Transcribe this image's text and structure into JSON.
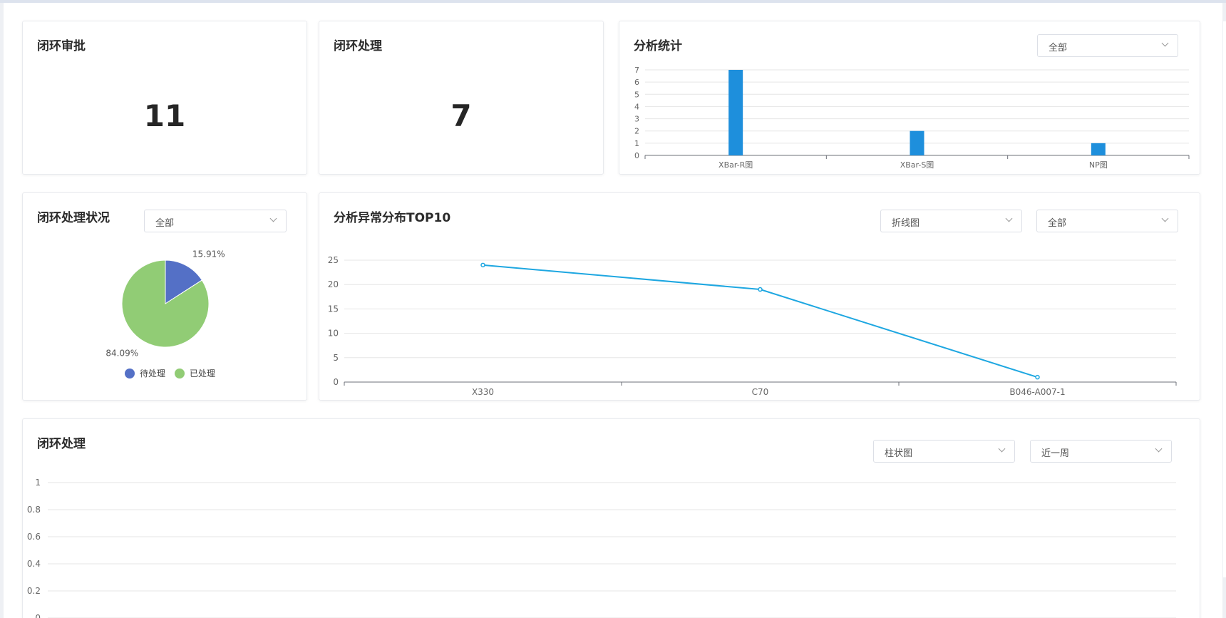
{
  "approval": {
    "title": "闭环审批",
    "value": "11"
  },
  "processing": {
    "title": "闭环处理",
    "value": "7"
  },
  "analysis_stats": {
    "title": "分析统计",
    "filter": "全部",
    "chart_data": {
      "type": "bar",
      "categories": [
        "XBar-R图",
        "XBar-S图",
        "NP图"
      ],
      "values": [
        7,
        2,
        1
      ],
      "yticks": [
        "0",
        "1",
        "2",
        "3",
        "4",
        "5",
        "6",
        "7"
      ],
      "ylim": [
        0,
        7
      ],
      "color": "#1e8fdc"
    }
  },
  "status": {
    "title": "闭环处理状况",
    "filter": "全部",
    "chart_data": {
      "type": "pie",
      "slices": [
        {
          "name": "待处理",
          "value": 15.91,
          "label": "15.91%",
          "color": "#5470c6"
        },
        {
          "name": "已处理",
          "value": 84.09,
          "label": "84.09%",
          "color": "#91cc75"
        }
      ]
    }
  },
  "anomaly": {
    "title": "分析异常分布TOP10",
    "chart_type_filter": "折线图",
    "scope_filter": "全部",
    "chart_data": {
      "type": "line",
      "categories": [
        "X330",
        "C70",
        "B046-A007-1"
      ],
      "values": [
        24,
        19,
        1
      ],
      "yticks": [
        "0",
        "5",
        "10",
        "15",
        "20",
        "25"
      ],
      "ylim": [
        0,
        25
      ],
      "color": "#1ea7e1"
    }
  },
  "closed_loop": {
    "title": "闭环处理",
    "chart_type_filter": "柱状图",
    "period_filter": "近一周",
    "chart_data": {
      "type": "bar",
      "categories": [],
      "values": [],
      "yticks": [
        "0",
        "0.2",
        "0.4",
        "0.6",
        "0.8",
        "1"
      ],
      "ylim": [
        0,
        1
      ]
    }
  }
}
